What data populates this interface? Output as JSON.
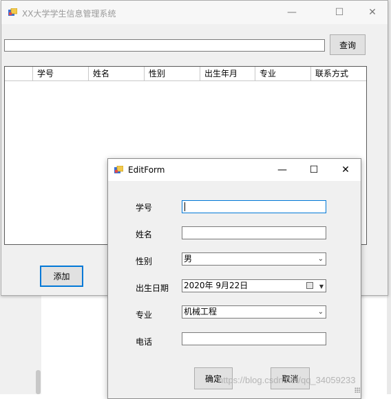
{
  "colors": {
    "accent": "#0078d7",
    "window_bg": "#f0f0f0",
    "titlebar_inactive_text": "#9a9a9a"
  },
  "main_window": {
    "title": "XX大学学生信息管理系统",
    "icon": "winforms-app-icon",
    "controls": {
      "minimize": "—",
      "maximize": "☐",
      "close": "✕"
    },
    "search": {
      "value": "",
      "button_label": "查询"
    },
    "grid": {
      "columns": [
        "",
        "学号",
        "姓名",
        "性别",
        "出生年月",
        "专业",
        "联系方式"
      ],
      "rows": []
    },
    "add_button_label": "添加"
  },
  "edit_form": {
    "title": "EditForm",
    "icon": "winforms-app-icon",
    "controls": {
      "minimize": "—",
      "maximize": "☐",
      "close": "✕"
    },
    "fields": {
      "id": {
        "label": "学号",
        "value": ""
      },
      "name": {
        "label": "姓名",
        "value": ""
      },
      "gender": {
        "label": "性别",
        "value": "男"
      },
      "birthdate": {
        "label": "出生日期",
        "value": "2020年  9月22日"
      },
      "major": {
        "label": "专业",
        "value": "机械工程"
      },
      "phone": {
        "label": "电话",
        "value": ""
      }
    },
    "ok_label": "确定",
    "cancel_label": "取消"
  },
  "watermark": "https://blog.csdn.net/qq_34059233"
}
